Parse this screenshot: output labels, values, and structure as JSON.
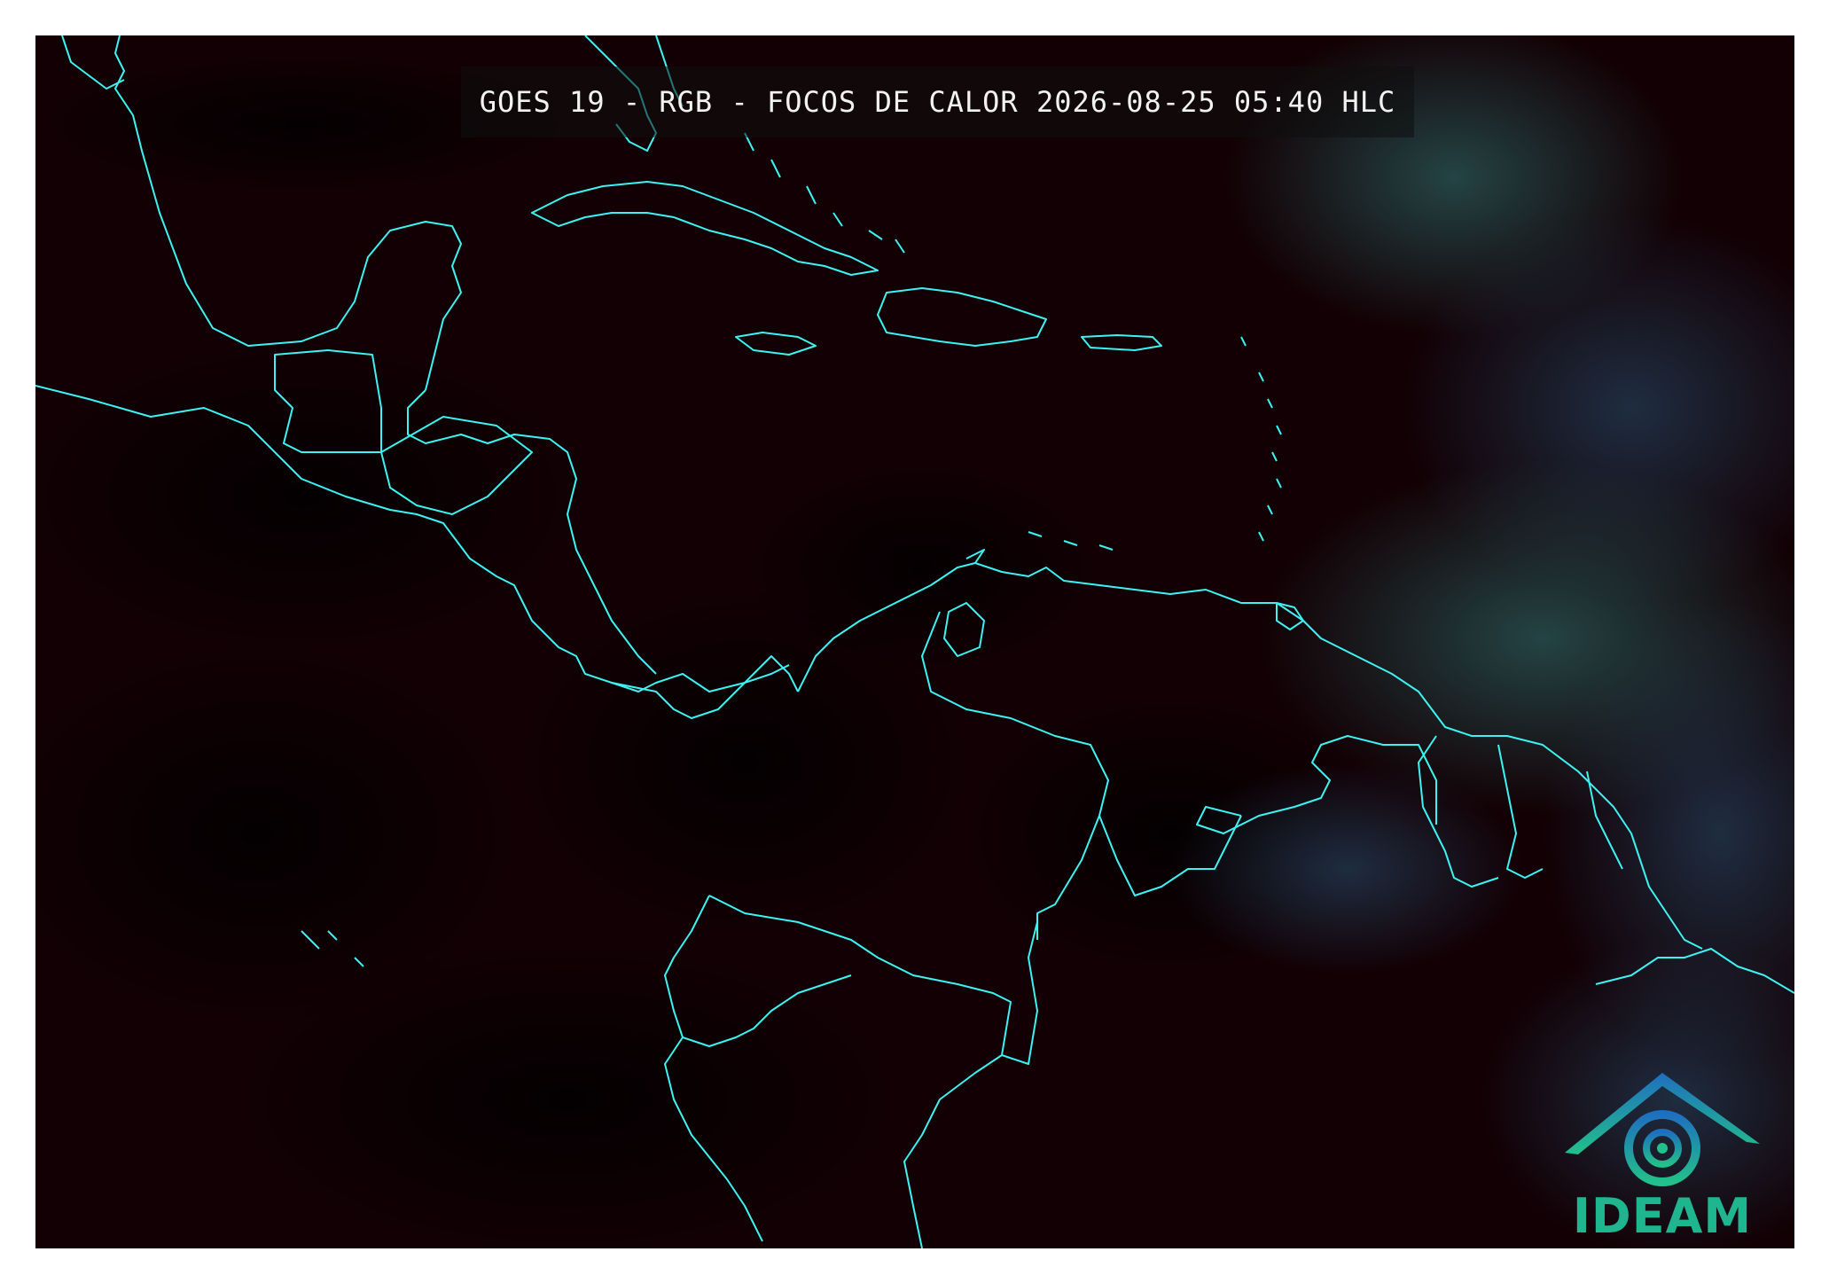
{
  "map": {
    "title": "GOES 19 - RGB - FOCOS DE CALOR 2026-08-25 05:40 HLC",
    "logo_text": "IDEAM",
    "colors": {
      "background": "#120004",
      "coastline": "#3ff2f2",
      "cloud_tint": "#1a3a3f",
      "logo_gradient_start": "#1f6fbf",
      "logo_gradient_end": "#22c08a"
    },
    "icons": [
      "ideam-logo-icon"
    ]
  }
}
